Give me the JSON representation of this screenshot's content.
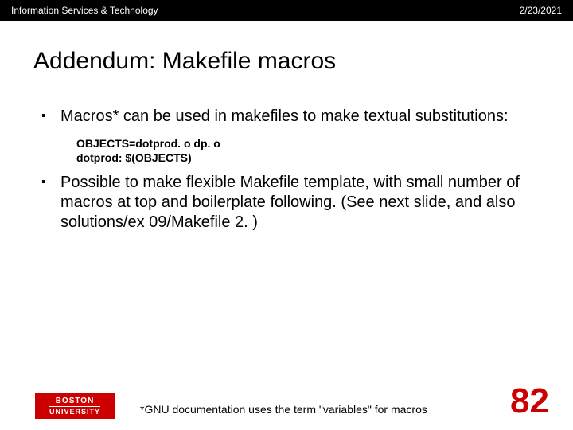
{
  "header": {
    "org": "Information Services & Technology",
    "date": "2/23/2021"
  },
  "title": "Addendum: Makefile macros",
  "bullets": [
    {
      "text": "Macros* can be used in makefiles to make textual substitutions:",
      "code": [
        "OBJECTS=dotprod. o dp. o",
        "dotprod: $(OBJECTS)"
      ]
    },
    {
      "text": "Possible to make flexible Makefile template, with small number of macros at top and boilerplate following. (See next slide, and also solutions/ex 09/Makefile 2. )"
    }
  ],
  "logo": {
    "line1": "BOSTON",
    "line2": "UNIVERSITY"
  },
  "footnote": "*GNU documentation uses the term \"variables\" for macros",
  "page": "82"
}
